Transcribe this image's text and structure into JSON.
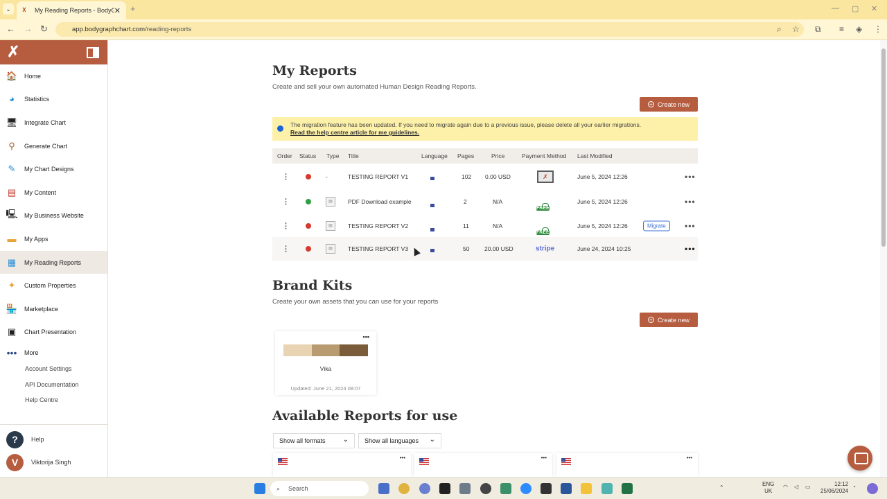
{
  "browser": {
    "tab_title": "My Reading Reports - BodyGra",
    "url_host": "app.bodygraphchart.com",
    "url_path": "/reading-reports"
  },
  "sidebar": {
    "items": [
      {
        "label": "Home",
        "icon": "home-icon"
      },
      {
        "label": "Statistics",
        "icon": "pie-chart-icon"
      },
      {
        "label": "Integrate Chart",
        "icon": "monitor-icon"
      },
      {
        "label": "Generate Chart",
        "icon": "bodygraph-icon"
      },
      {
        "label": "My Chart Designs",
        "icon": "design-icon"
      },
      {
        "label": "My Content",
        "icon": "content-icon"
      },
      {
        "label": "My Business Website",
        "icon": "website-icon"
      },
      {
        "label": "My Apps",
        "icon": "apps-icon"
      },
      {
        "label": "My Reading Reports",
        "icon": "reports-icon"
      },
      {
        "label": "Custom Properties",
        "icon": "properties-icon"
      },
      {
        "label": "Marketplace",
        "icon": "marketplace-icon"
      },
      {
        "label": "Chart Presentation",
        "icon": "presentation-icon"
      }
    ],
    "more_label": "More",
    "sub_items": [
      "Account Settings",
      "API Documentation",
      "Help Centre"
    ],
    "help_label": "Help",
    "user_initial": "V",
    "user_name": "Viktorija Singh"
  },
  "reports": {
    "title": "My Reports",
    "subtitle": "Create and sell your own automated Human Design Reading Reports.",
    "create_label": "Create new",
    "notice_text": "The migration feature has been updated. If you need to migrate again due to a previous issue, please delete all your earlier migrations.",
    "notice_link": "Read the help centre article for me guidelines.",
    "columns": [
      "Order",
      "Status",
      "Type",
      "Title",
      "Language",
      "Pages",
      "Price",
      "Payment Method",
      "Last Modified"
    ],
    "rows": [
      {
        "status": "red",
        "type": "-",
        "title": "TESTING REPORT V1",
        "pages": "102",
        "price": "0.00 USD",
        "payment": "monitor",
        "modified": "June 5, 2024 12:26",
        "migrate": ""
      },
      {
        "status": "green",
        "type": "doc",
        "title": "PDF Download example",
        "pages": "2",
        "price": "N/A",
        "payment": "FREE",
        "modified": "June 5, 2024 12:26",
        "migrate": ""
      },
      {
        "status": "red",
        "type": "doc",
        "title": "TESTING REPORT V2",
        "pages": "11",
        "price": "N/A",
        "payment": "FREE",
        "modified": "June 5, 2024 12:26",
        "migrate": "Migrate"
      },
      {
        "status": "red",
        "type": "doc",
        "title": "TESTING REPORT V3",
        "pages": "50",
        "price": "20.00 USD",
        "payment": "stripe",
        "modified": "June 24, 2024 10:25",
        "migrate": ""
      }
    ]
  },
  "brand_kits": {
    "title": "Brand Kits",
    "subtitle": "Create your own assets that you can use for your reports",
    "create_label": "Create new",
    "card": {
      "name": "Vika",
      "updated": "Updated: June 21, 2024 08:07",
      "colors": [
        "#e8d3b2",
        "#b99b72",
        "#7a5c3a"
      ]
    }
  },
  "available": {
    "title": "Available Reports for use",
    "format_filter": "Show all formats",
    "language_filter": "Show all languages"
  },
  "colors": {
    "accent": "#b65d40",
    "status_red": "#d63a2f",
    "status_green": "#2ea043"
  },
  "taskbar": {
    "search_placeholder": "Search",
    "lang": "ENG",
    "region": "UK",
    "time": "12:12",
    "date": "25/06/2024"
  }
}
